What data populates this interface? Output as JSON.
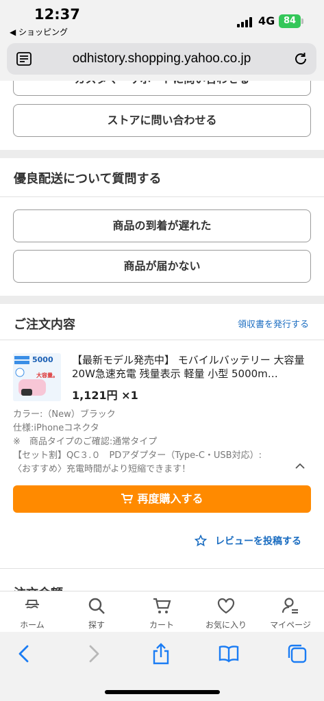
{
  "status_bar": {
    "time": "12:37",
    "back_app": "◀ ショッピング",
    "network": "4G",
    "battery": "84"
  },
  "url_bar": {
    "url": "odhistory.shopping.yahoo.co.jp",
    "icons": [
      "reader-icon",
      "reload-icon"
    ]
  },
  "contact": {
    "partial_button": "カスタマーサポートに問い合わせる",
    "store_button": "ストアに問い合わせる"
  },
  "delivery": {
    "title": "優良配送について質問する",
    "late_button": "商品の到着が遅れた",
    "not_arrived_button": "商品が届かない"
  },
  "order": {
    "title": "ご注文内容",
    "receipt_link": "領収書を発行する",
    "product_name": "【最新モデル発売中】 モバイルバッテリー 大容量 20W急速充電 残量表示 軽量 小型 5000m…",
    "price": "1,121円 ×1",
    "thumb_text": "5000",
    "thumb_text2": "大容量。",
    "specs": [
      "カラー:（New）ブラック",
      "仕様:iPhoneコネクタ",
      "※　商品タイプのご確認:通常タイプ",
      "【セット割】QC３.０　PDアダプター（Type-C・USB対応）:",
      "〈おすすめ〉充電時間がより短縮できます！"
    ],
    "rebuy_button": "再度購入する",
    "review_link": "レビューを投稿する",
    "partial_next": "注文金額"
  },
  "app_nav": [
    {
      "label": "ホーム",
      "icon": "home-icon"
    },
    {
      "label": "探す",
      "icon": "search-icon"
    },
    {
      "label": "カート",
      "icon": "cart-icon"
    },
    {
      "label": "お気に入り",
      "icon": "heart-icon"
    },
    {
      "label": "マイページ",
      "icon": "user-icon"
    }
  ],
  "colors": {
    "accent_orange": "#ff8a00",
    "link_blue": "#1b6dc1",
    "safari_blue": "#1a7cf4"
  }
}
